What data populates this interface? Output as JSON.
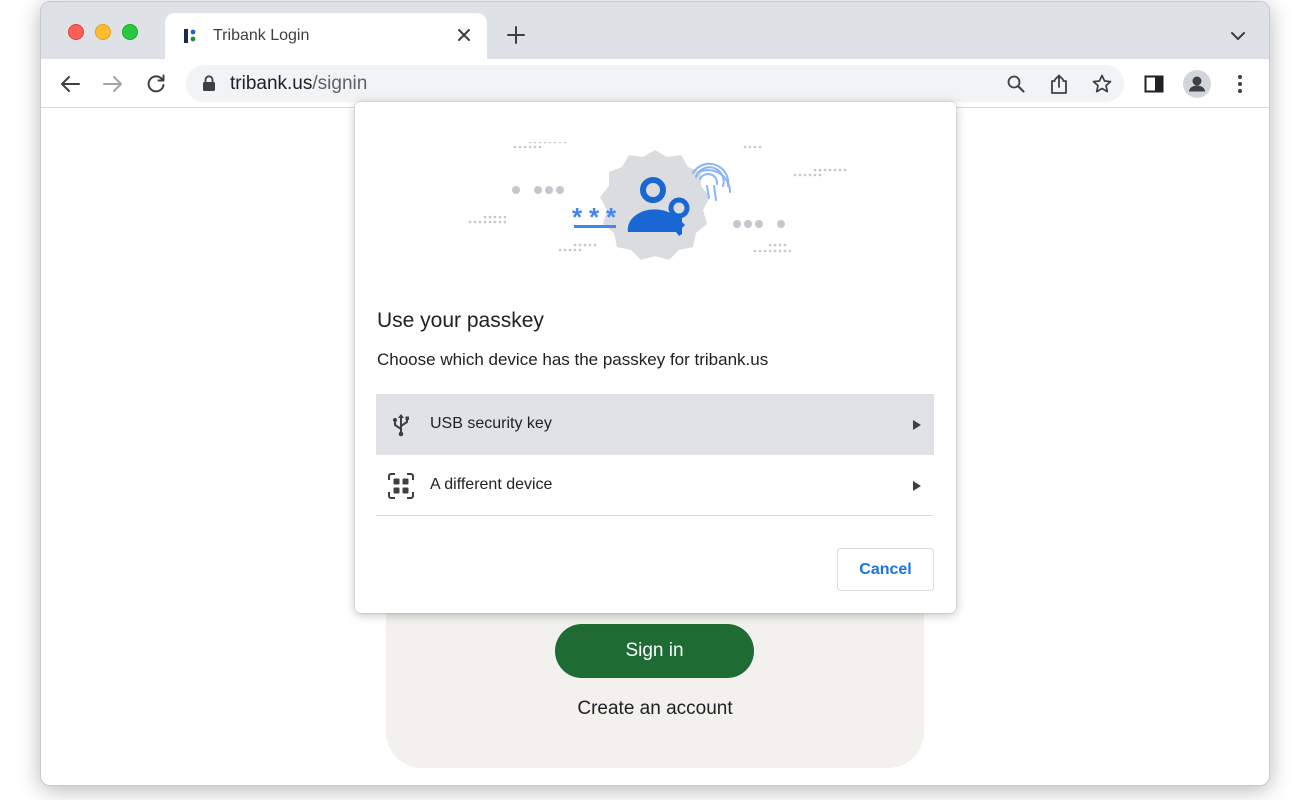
{
  "browser": {
    "tab_title": "Tribank Login",
    "url_host": "tribank.us",
    "url_path": "/signin"
  },
  "page": {
    "sign_in_label": "Sign in",
    "create_account_label": "Create an account"
  },
  "dialog": {
    "title": "Use your passkey",
    "description": "Choose which device has the passkey for tribank.us",
    "options": [
      {
        "label": "USB security key",
        "icon": "usb-icon",
        "highlighted": true
      },
      {
        "label": "A different device",
        "icon": "qr-code-icon",
        "highlighted": false
      }
    ],
    "cancel_label": "Cancel"
  },
  "colors": {
    "accent_blue": "#1a73e8",
    "sign_in_green": "#1e6b33",
    "passkey_blue": "#1967d2"
  }
}
